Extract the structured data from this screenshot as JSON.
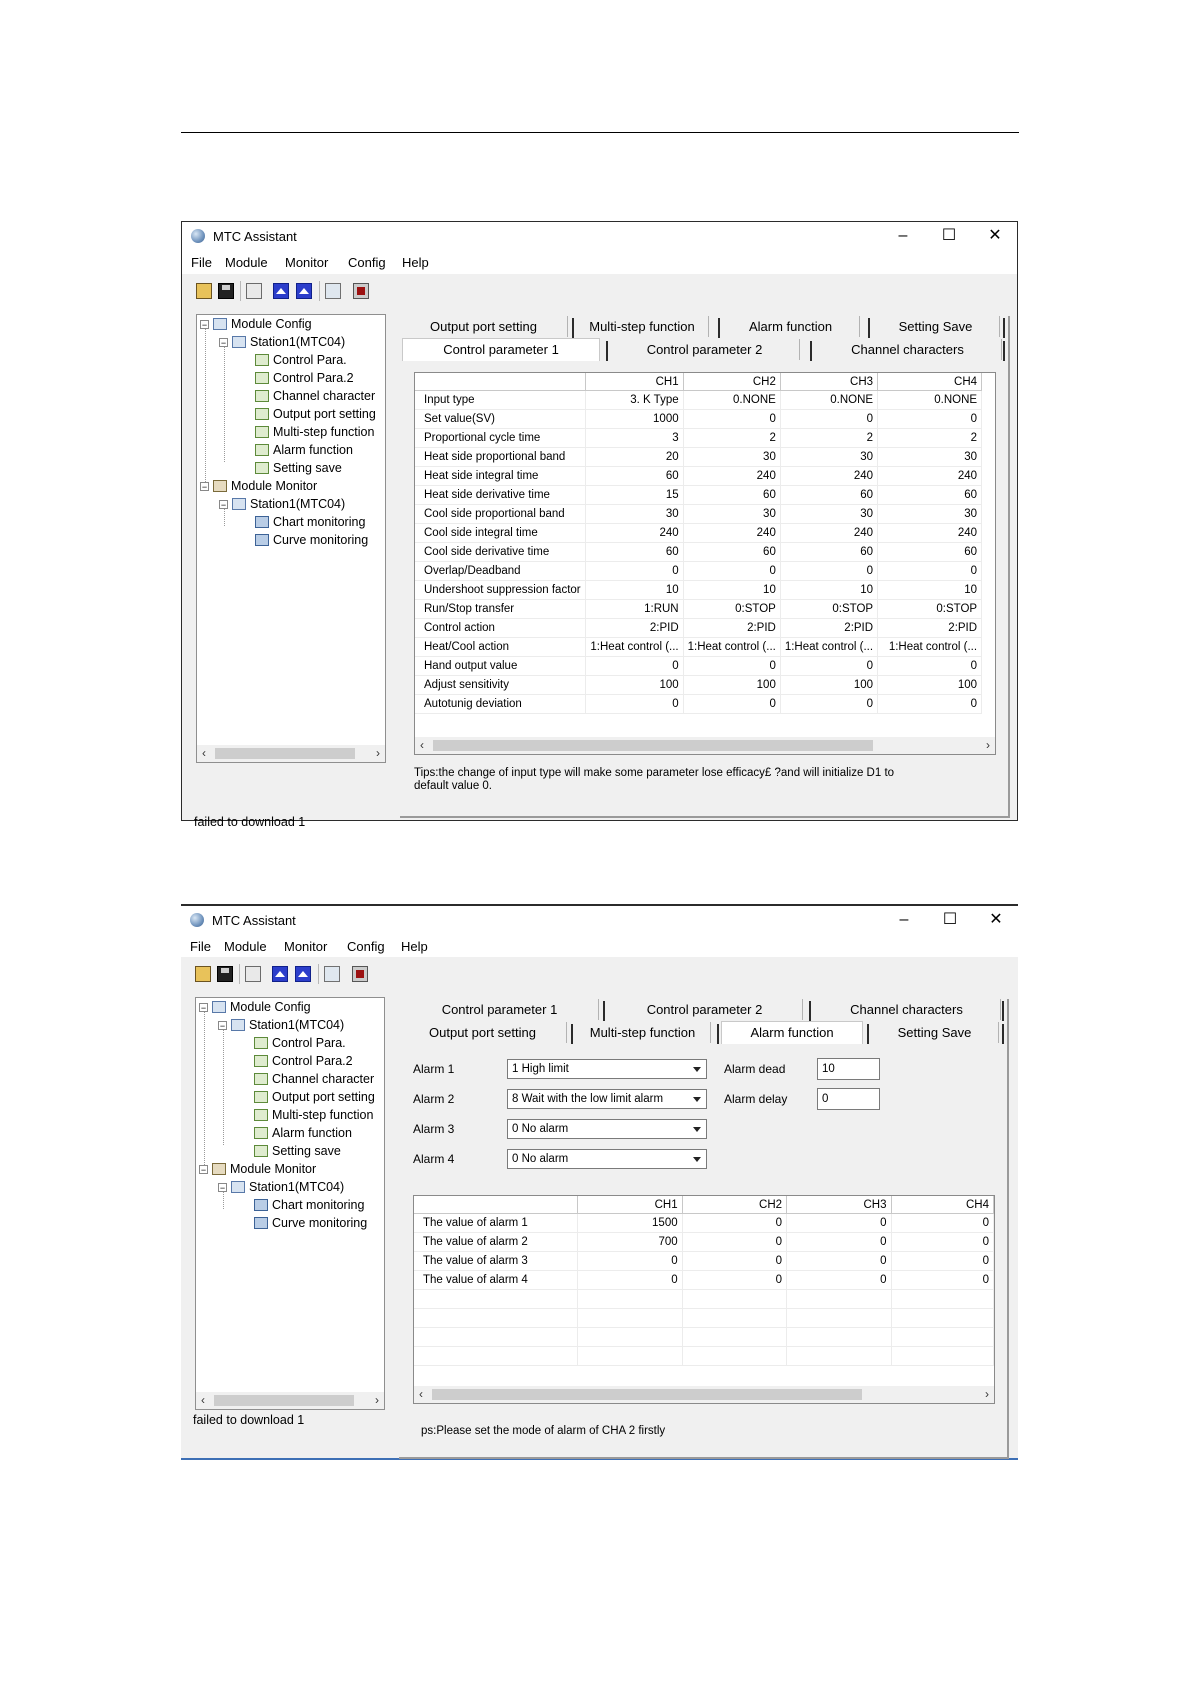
{
  "app": {
    "title": "MTC Assistant",
    "min": "–",
    "max": "☐",
    "close": "✕"
  },
  "menu": {
    "file": "File",
    "module": "Module",
    "monitor": "Monitor",
    "config": "Config",
    "help": "Help"
  },
  "toolbar_icons": [
    "open-folder-icon",
    "save-icon",
    "document-icon",
    "upload-icon",
    "download-icon",
    "monitor-icon",
    "stop-icon"
  ],
  "tree": {
    "module_config": "Module Config",
    "station1": "Station1(MTC04)",
    "control_para": "Control Para.",
    "control_para2": "Control Para.2",
    "channel_character": "Channel character",
    "output_port_setting": "Output port setting",
    "multistep_function": "Multi-step function",
    "alarm_function": "Alarm function",
    "setting_save": "Setting save",
    "module_monitor": "Module Monitor",
    "station1_mon": "Station1(MTC04)",
    "chart_monitoring": "Chart monitoring",
    "curve_monitoring": "Curve monitoring"
  },
  "status": {
    "text": "failed to download  1"
  },
  "tabs": {
    "output_port": "Output port setting",
    "multistep": "Multi-step function",
    "alarm": "Alarm function",
    "setting_save": "Setting Save",
    "control1": "Control parameter 1",
    "control2": "Control parameter 2",
    "channel": "Channel characters"
  },
  "grid1": {
    "columns": [
      "",
      "CH1",
      "CH2",
      "CH3",
      "CH4"
    ],
    "rows": [
      [
        "Input type",
        "3. K Type",
        "0.NONE",
        "0.NONE",
        "0.NONE"
      ],
      [
        "Set value(SV)",
        "1000",
        "0",
        "0",
        "0"
      ],
      [
        "Proportional cycle time",
        "3",
        "2",
        "2",
        "2"
      ],
      [
        "Heat side proportional band",
        "20",
        "30",
        "30",
        "30"
      ],
      [
        "Heat side integral time",
        "60",
        "240",
        "240",
        "240"
      ],
      [
        "Heat side derivative time",
        "15",
        "60",
        "60",
        "60"
      ],
      [
        "Cool side proportional band",
        "30",
        "30",
        "30",
        "30"
      ],
      [
        "Cool side integral time",
        "240",
        "240",
        "240",
        "240"
      ],
      [
        "Cool side derivative time",
        "60",
        "60",
        "60",
        "60"
      ],
      [
        "Overlap/Deadband",
        "0",
        "0",
        "0",
        "0"
      ],
      [
        "Undershoot suppression factor",
        "10",
        "10",
        "10",
        "10"
      ],
      [
        "Run/Stop transfer",
        "1:RUN",
        "0:STOP",
        "0:STOP",
        "0:STOP"
      ],
      [
        "Control action",
        "2:PID",
        "2:PID",
        "2:PID",
        "2:PID"
      ],
      [
        "Heat/Cool action",
        "1:Heat control (...",
        "1:Heat control (...",
        "1:Heat control (...",
        "1:Heat control (..."
      ],
      [
        "Hand output value",
        "0",
        "0",
        "0",
        "0"
      ],
      [
        "Adjust sensitivity",
        "100",
        "100",
        "100",
        "100"
      ],
      [
        "Autotunig deviation",
        "0",
        "0",
        "0",
        "0"
      ]
    ]
  },
  "tip1": {
    "line1": "Tips:the change of input type will make some parameter lose efficacy£ ?and will initialize D1 to",
    "line2": "default value 0."
  },
  "alarm": {
    "alarm1_label": "Alarm 1",
    "alarm1_value": "1 High limit",
    "alarm2_label": "Alarm 2",
    "alarm2_value": "8  Wait with the low limit alarm",
    "alarm3_label": "Alarm 3",
    "alarm3_value": "0 No alarm",
    "alarm4_label": "Alarm 4",
    "alarm4_value": "0 No alarm",
    "dead_label": "Alarm dead",
    "dead_value": "10",
    "delay_label": "Alarm delay",
    "delay_value": "0"
  },
  "grid2": {
    "columns": [
      "",
      "CH1",
      "CH2",
      "CH3",
      "CH4"
    ],
    "rows": [
      [
        "The value of alarm 1",
        "1500",
        "0",
        "0",
        "0"
      ],
      [
        "The value of alarm 2",
        "700",
        "0",
        "0",
        "0"
      ],
      [
        "The value of alarm 3",
        "0",
        "0",
        "0",
        "0"
      ],
      [
        "The value of alarm 4",
        "0",
        "0",
        "0",
        "0"
      ],
      [
        "",
        "",
        "",
        "",
        ""
      ],
      [
        "",
        "",
        "",
        "",
        ""
      ],
      [
        "",
        "",
        "",
        "",
        ""
      ],
      [
        "",
        "",
        "",
        "",
        ""
      ]
    ]
  },
  "tip2": {
    "text": "ps:Please set the mode of alarm of CHA 2 firstly"
  }
}
